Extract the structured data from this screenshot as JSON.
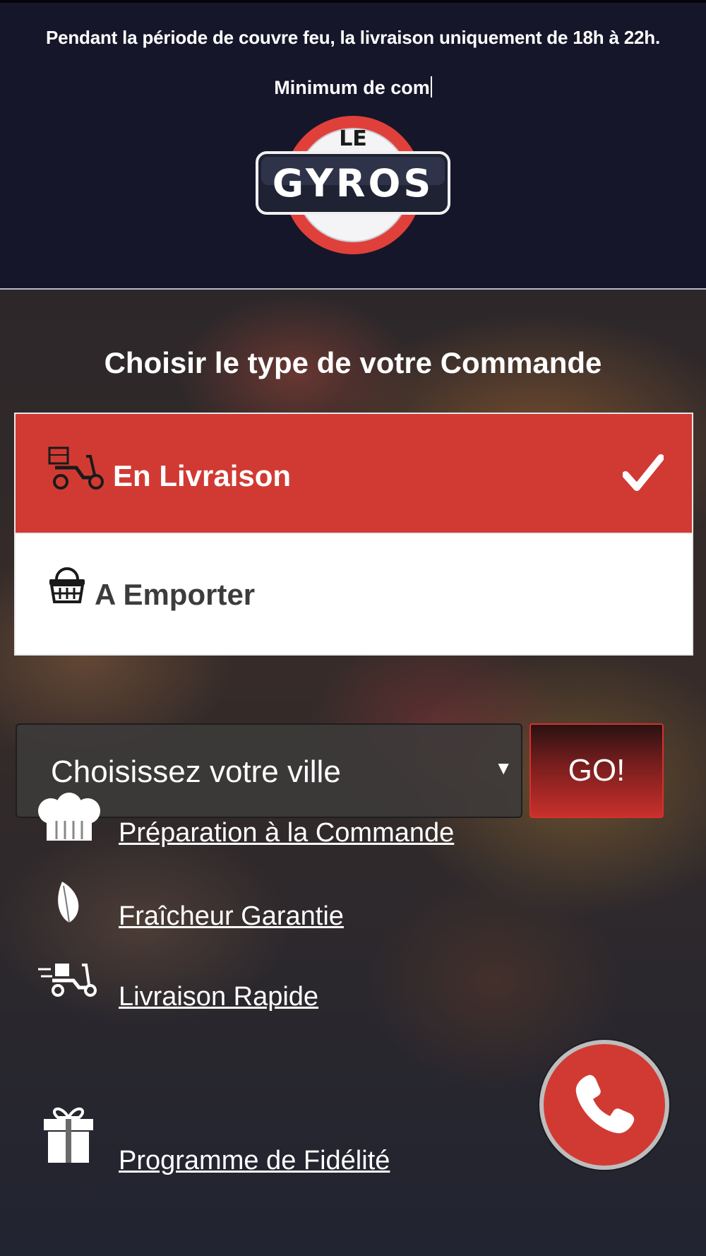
{
  "header": {
    "notice": "Pendant la période de couvre feu, la livraison uniquement de 18h à 22h.",
    "ticker": "Minimum de com",
    "logo": {
      "line1": "LE",
      "line2": "GYROS"
    }
  },
  "order": {
    "title": "Choisir le type de votre Commande",
    "options": [
      {
        "label": "En Livraison",
        "icon": "scooter-delivery-icon",
        "selected": true
      },
      {
        "label": "A Emporter",
        "icon": "basket-icon",
        "selected": false
      }
    ]
  },
  "city": {
    "placeholder": "Choisissez votre ville",
    "go_label": "GO!"
  },
  "features": [
    {
      "label": "Préparation à la Commande",
      "icon": "chef-hat-icon"
    },
    {
      "label": "Fraîcheur Garantie",
      "icon": "leaf-icon"
    },
    {
      "label": "Livraison Rapide",
      "icon": "fast-scooter-icon"
    },
    {
      "label": "Programme de Fidélité",
      "icon": "gift-icon"
    }
  ],
  "call": {
    "icon": "phone-icon"
  },
  "colors": {
    "header_bg": "#16162a",
    "accent": "#d13a33",
    "text_light": "#ffffff"
  }
}
